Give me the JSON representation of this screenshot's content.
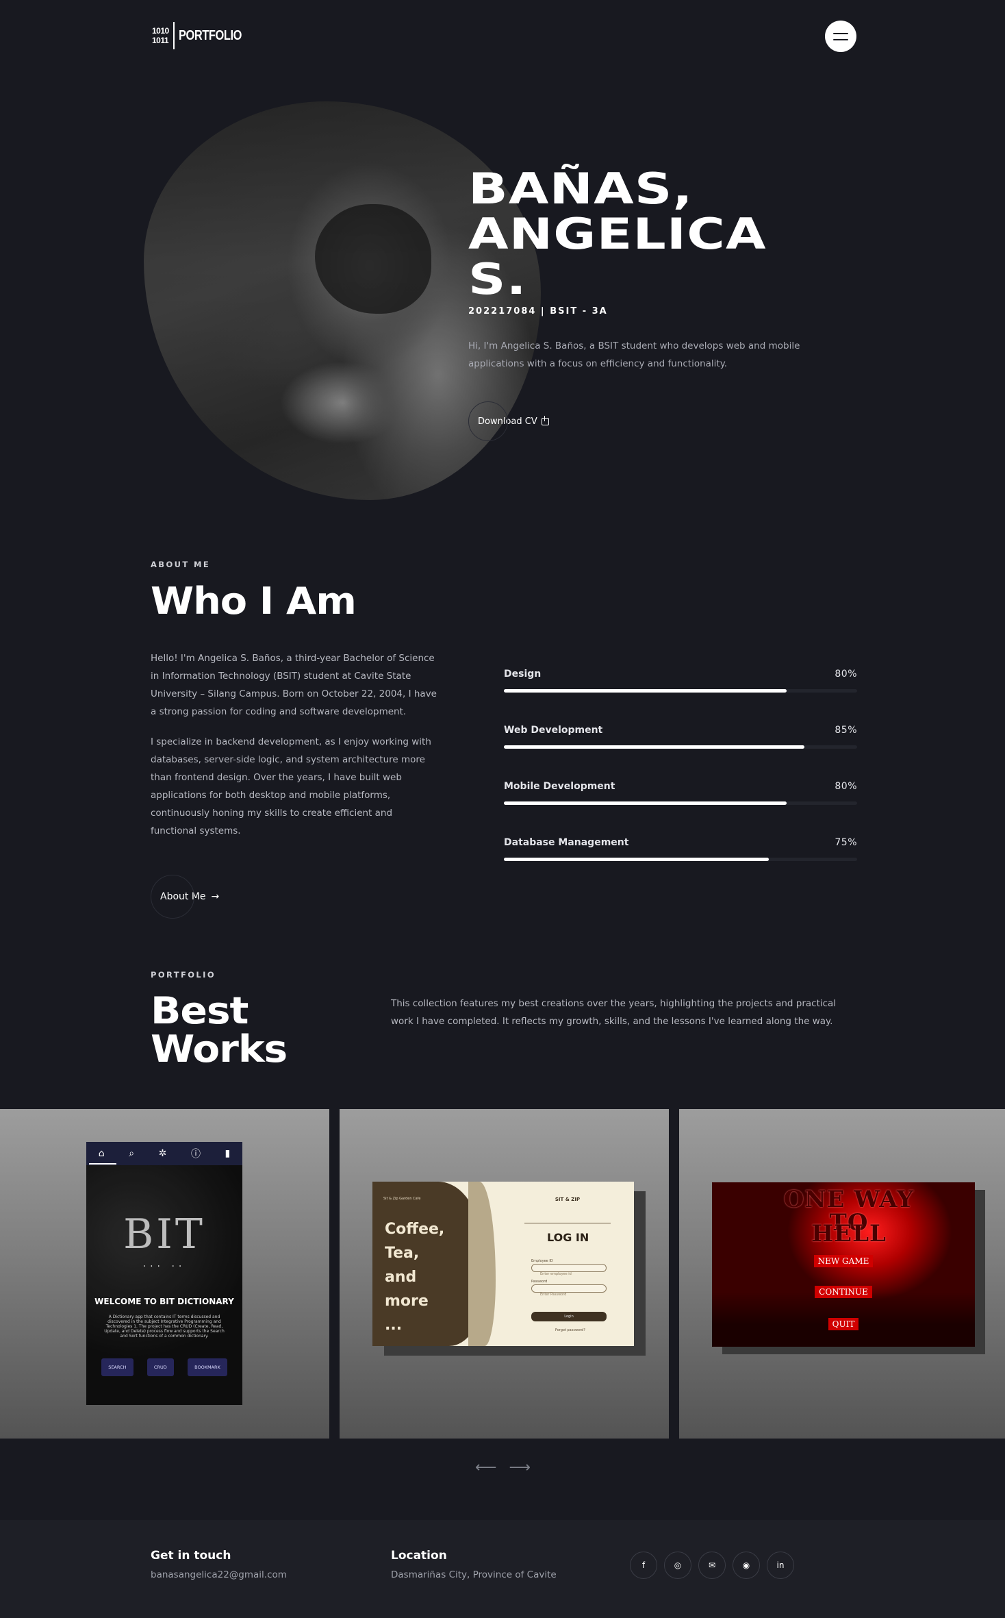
{
  "header": {
    "logo_bits_top": "1010",
    "logo_bits_bottom": "1011",
    "logo_text": "PORTFOLIO",
    "menu_icon": "hamburger-icon"
  },
  "hero": {
    "name_line1": "BAÑAS,",
    "name_line2": "ANGELICA",
    "name_line3": "S.",
    "id_line": "202217084 | BSIT - 3A",
    "description": "Hi, I'm Angelica S. Baños, a BSIT student who develops web and mobile applications with a focus on efficiency and functionality.",
    "cv_label": "Download CV",
    "cv_icon": "download-icon"
  },
  "about": {
    "eyebrow": "ABOUT ME",
    "title": "Who I Am",
    "paragraph1": "Hello! I'm Angelica S. Baños, a third-year Bachelor of Science in Information Technology (BSIT) student at Cavite State University – Silang Campus. Born on October 22, 2004, I have a strong passion for coding and software development.",
    "paragraph2": "I specialize in backend development, as I enjoy working with databases, server-side logic, and system architecture more than frontend design. Over the years, I have built web applications for both desktop and mobile platforms, continuously honing my skills to create efficient and functional systems.",
    "button_label": "About Me",
    "button_arrow": "→",
    "skills": [
      {
        "name": "Design",
        "percent": "80%",
        "value": 80
      },
      {
        "name": "Web Development",
        "percent": "85%",
        "value": 85
      },
      {
        "name": "Mobile Development",
        "percent": "80%",
        "value": 80
      },
      {
        "name": "Database Management",
        "percent": "75%",
        "value": 75
      }
    ]
  },
  "portfolio": {
    "eyebrow": "PORTFOLIO",
    "title_line1": "Best",
    "title_line2": "Works",
    "description": "This collection features my best creations over the years, highlighting the projects and practical work I have completed. It reflects my growth, skills, and the lessons I've learned along the way.",
    "card1": {
      "logo": "BIT",
      "dots": "... ..",
      "welcome": "WELCOME TO BIT DICTIONARY",
      "blurb": "A Dictionary app that contains IT terms discussed and discovered in the subject Integrative Programming and Technologies 1. The project has the CRUD (Create, Read, Update, and Delete) process flow and supports the Search and Sort functions of a common dictionary.",
      "buttons": [
        "SEARCH",
        "CRUD",
        "BOOKMARK"
      ]
    },
    "card2": {
      "tiny": "Sit & Zip Garden Cafe",
      "headline": [
        "Coffee,",
        "Tea,",
        "and",
        "more",
        "..."
      ],
      "brand": "SIT & ZIP",
      "login": "LOG IN",
      "employee_label": "Employee ID",
      "employee_placeholder": "Enter employee id",
      "password_label": "Password",
      "password_placeholder": "Enter Password",
      "login_button": "Login",
      "forgot": "Forgot password?"
    },
    "card3": {
      "title_line1": "ONE WAY",
      "title_line2": "TO",
      "title_line3": "HELL",
      "options": [
        "NEW GAME",
        "CONTINUE",
        "QUIT"
      ]
    },
    "prev_arrow": "⟵",
    "next_arrow": "⟶"
  },
  "footer": {
    "contact_title": "Get in touch",
    "email": "banasangelica22@gmail.com",
    "location_title": "Location",
    "location": "Dasmariñas City, Province of Cavite",
    "socials": [
      "facebook-icon",
      "instagram-icon",
      "email-icon",
      "github-icon",
      "linkedin-icon"
    ]
  }
}
